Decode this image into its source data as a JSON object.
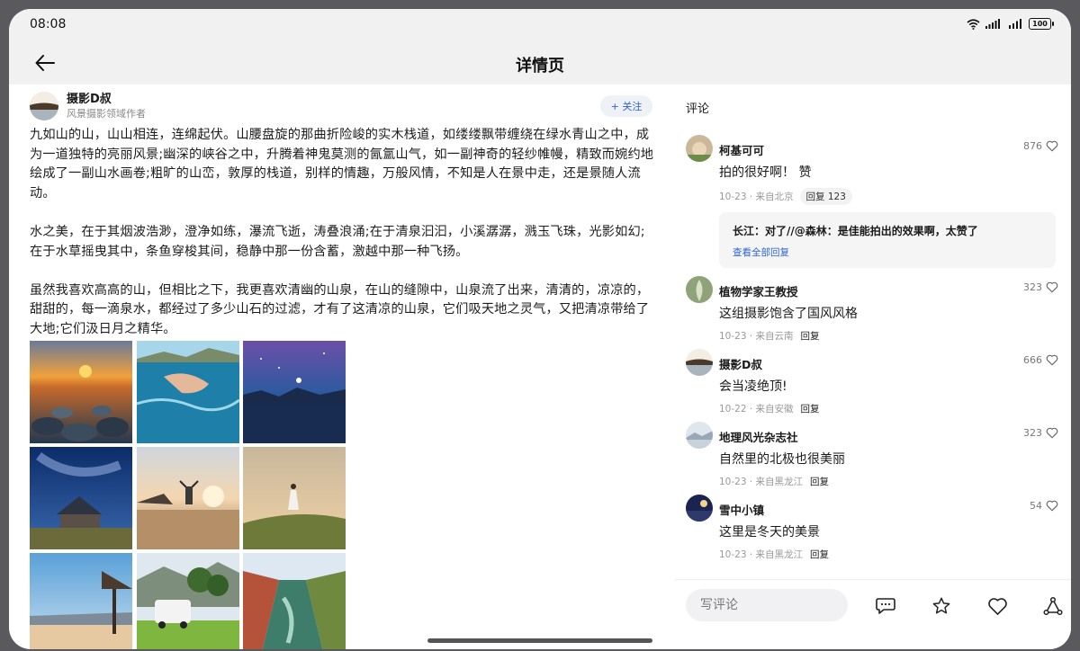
{
  "status_bar": {
    "time": "08:08",
    "battery": "100",
    "icons": [
      "wifi-icon",
      "signal-icon",
      "battery-icon"
    ]
  },
  "header": {
    "title": "详情页",
    "back_icon": "back-arrow-icon"
  },
  "author": {
    "name": "摄影D叔",
    "subtitle": "风景摄影领域作者",
    "follow_label": "+ 关注"
  },
  "article": {
    "paragraphs": [
      "九如山的山，山山相连，连绵起伏。山腰盘旋的那曲折险峻的实木栈道，如缕缕飘带缠绕在绿水青山之中，成为一道独特的亮丽风景;幽深的峡谷之中，升腾着神鬼莫测的氤氲山气，如一副神奇的轻纱帷幔，精致而婉约地绘成了一副山水画卷;粗旷的山峦，敦厚的栈道，别样的情趣，万般风情，不知是人在景中走，还是景随人流动。",
      "水之美，在于其烟波浩渺，澄净如练，瀑流飞逝，涛叠浪涌;在于清泉汩汩，小溪潺潺，溅玉飞珠，光影如幻;在于水草摇曳其中，条鱼穿梭其间，稳静中那一份含蓄，激越中那一种飞扬。",
      "虽然我喜欢高高的山，但相比之下，我更喜欢清幽的山泉，在山的缝隙中，山泉流了出来，清清的，凉凉的，甜甜的，每一滴泉水，都经过了多少山石的过滤，才有了这清凉的山泉，它们吸天地之灵气，又把清凉带给了大地;它们汲日月之精华。"
    ]
  },
  "photos": [
    "sunset-pebbles",
    "swimmer",
    "night-sky-lake",
    "milky-way-church",
    "beach-person",
    "hill-girl",
    "pavilion-lake",
    "camper-van",
    "canyon-river"
  ],
  "comments": {
    "heading": "评论",
    "items": [
      {
        "name": "柯基可可",
        "text": "拍的很好啊！ 赞",
        "likes": "876",
        "meta": "10-23 · 来自北京",
        "reply": "回复 123"
      },
      {
        "name": "植物学家王教授",
        "text": "这组摄影饱含了国风风格",
        "likes": "323",
        "meta": "10-23 · 来自云南",
        "reply": "回复"
      },
      {
        "name": "摄影D叔",
        "text": "会当凌绝顶!",
        "likes": "666",
        "meta": "10-22 · 来自安徽",
        "reply": "回复"
      },
      {
        "name": "地理风光杂志社",
        "text": "自然里的北极也很美丽",
        "likes": "323",
        "meta": "10-23 · 来自黑龙江",
        "reply": "回复"
      },
      {
        "name": "雪中小镇",
        "text": "这里是冬天的美景",
        "likes": "54",
        "meta": "10-23 · 来自黑龙江",
        "reply": "回复"
      }
    ],
    "reply_preview": {
      "text": "长江：对了//@森林：是佳能拍出的效果啊，太赞了",
      "view_all": "查看全部回复"
    }
  },
  "bottom_bar": {
    "input_placeholder": "写评论",
    "icons": [
      "comment-icon",
      "star-icon",
      "heart-icon",
      "share-icon"
    ]
  },
  "colors": {
    "accent": "#2e63d6",
    "bar_bg": "#f1f1f1"
  }
}
